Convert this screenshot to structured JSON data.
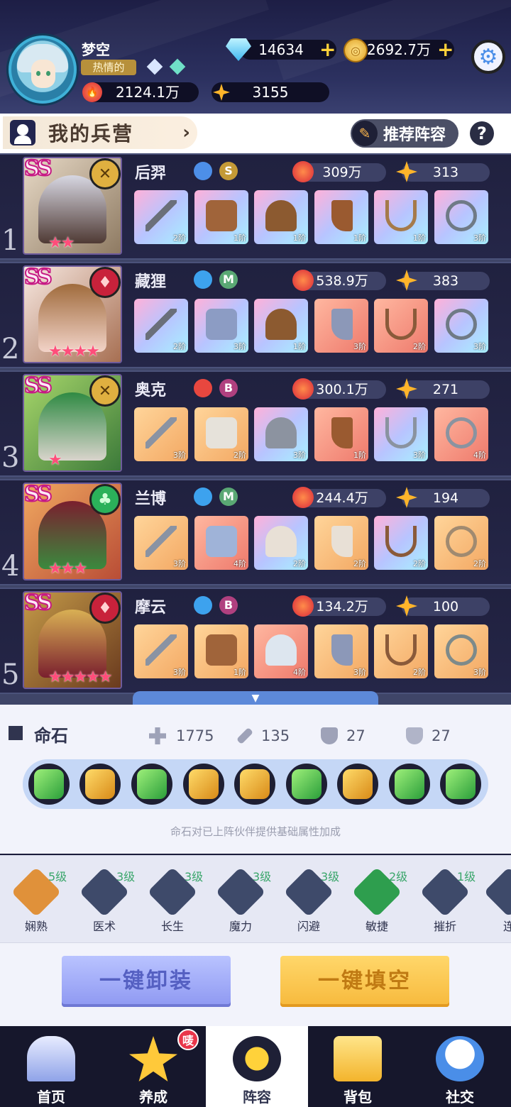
{
  "player": {
    "name": "梦空",
    "tag": "热情的",
    "power": "2124.1万",
    "score": "3155"
  },
  "currency": {
    "diamonds": "14634",
    "gold": "2692.7万",
    "plus": "+"
  },
  "section": {
    "title": "我的兵营",
    "recommend_label": "推荐阵容",
    "help_label": "?"
  },
  "heroes": [
    {
      "index": "1",
      "name": "后羿",
      "rank": "SS",
      "grade": "S",
      "stars": "★★",
      "power": "309万",
      "score": "313",
      "gear": [
        {
          "lvl": "2阶"
        },
        {
          "lvl": "1阶"
        },
        {
          "lvl": "1阶"
        },
        {
          "lvl": "1阶"
        },
        {
          "lvl": "1阶"
        },
        {
          "lvl": "3阶"
        }
      ]
    },
    {
      "index": "2",
      "name": "藏狸",
      "rank": "SS",
      "grade": "M",
      "stars": "★★★★",
      "power": "538.9万",
      "score": "383",
      "gear": [
        {
          "lvl": "2阶"
        },
        {
          "lvl": "3阶"
        },
        {
          "lvl": "1阶"
        },
        {
          "lvl": "3阶"
        },
        {
          "lvl": "2阶"
        },
        {
          "lvl": "3阶"
        }
      ]
    },
    {
      "index": "3",
      "name": "奥克",
      "rank": "SS",
      "grade": "B",
      "stars": "★",
      "power": "300.1万",
      "score": "271",
      "gear": [
        {
          "lvl": "3阶"
        },
        {
          "lvl": "2阶"
        },
        {
          "lvl": "3阶"
        },
        {
          "lvl": "1阶"
        },
        {
          "lvl": "3阶"
        },
        {
          "lvl": "4阶"
        }
      ]
    },
    {
      "index": "4",
      "name": "兰博",
      "rank": "SS",
      "grade": "M",
      "stars": "★★★",
      "power": "244.4万",
      "score": "194",
      "gear": [
        {
          "lvl": "3阶"
        },
        {
          "lvl": "4阶"
        },
        {
          "lvl": "2阶"
        },
        {
          "lvl": "2阶"
        },
        {
          "lvl": "2阶"
        },
        {
          "lvl": "2阶"
        }
      ]
    },
    {
      "index": "5",
      "name": "摩云",
      "rank": "SS",
      "grade": "B",
      "stars": "★★★★★",
      "power": "134.2万",
      "score": "100",
      "gear": [
        {
          "lvl": "3阶"
        },
        {
          "lvl": "1阶"
        },
        {
          "lvl": "4阶"
        },
        {
          "lvl": "3阶"
        },
        {
          "lvl": "2阶"
        },
        {
          "lvl": "3阶"
        }
      ]
    }
  ],
  "fate": {
    "title": "命石",
    "hp": "1775",
    "atk": "135",
    "def1": "27",
    "def2": "27",
    "desc": "命石对已上阵伙伴提供基础属性加成"
  },
  "skills": [
    {
      "name": "娴熟",
      "level": "5级"
    },
    {
      "name": "医术",
      "level": "3级"
    },
    {
      "name": "长生",
      "level": "3级"
    },
    {
      "name": "魔力",
      "level": "3级"
    },
    {
      "name": "闪避",
      "level": "3级"
    },
    {
      "name": "敏捷",
      "level": "2级"
    },
    {
      "name": "摧折",
      "level": "1级"
    },
    {
      "name": "连"
    }
  ],
  "actions": {
    "unequip": "一键卸装",
    "fill": "一键填空"
  },
  "nav": {
    "home": "首页",
    "train": "养成",
    "lineup": "阵容",
    "bag": "背包",
    "social": "社交",
    "badge": "唛"
  },
  "colors": {
    "accent": "#f7b93c",
    "bg": "#1a1b3a"
  }
}
